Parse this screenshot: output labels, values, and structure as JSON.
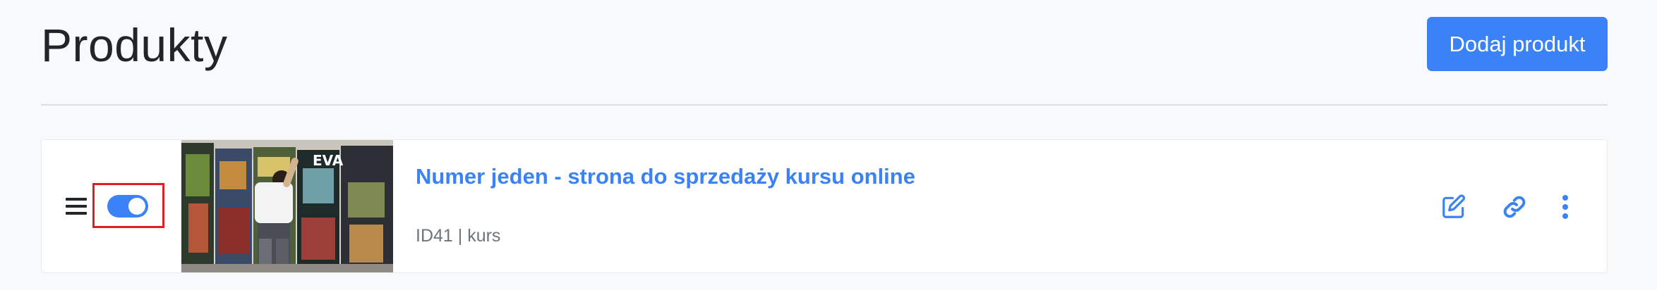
{
  "header": {
    "title": "Produkty",
    "add_button_label": "Dodaj produkt"
  },
  "products": [
    {
      "title": "Numer jeden - strona do sprzedaży kursu online",
      "meta": "ID41 | kurs",
      "thumbnail_overlay_text": "EVA",
      "enabled": true,
      "actions": [
        "edit-icon",
        "link-icon",
        "more-vertical-icon"
      ]
    }
  ],
  "colors": {
    "accent": "#3b82f6",
    "highlight": "#e02020",
    "background": "#f8f9fa",
    "text": "#212529",
    "muted": "#6c757d"
  }
}
